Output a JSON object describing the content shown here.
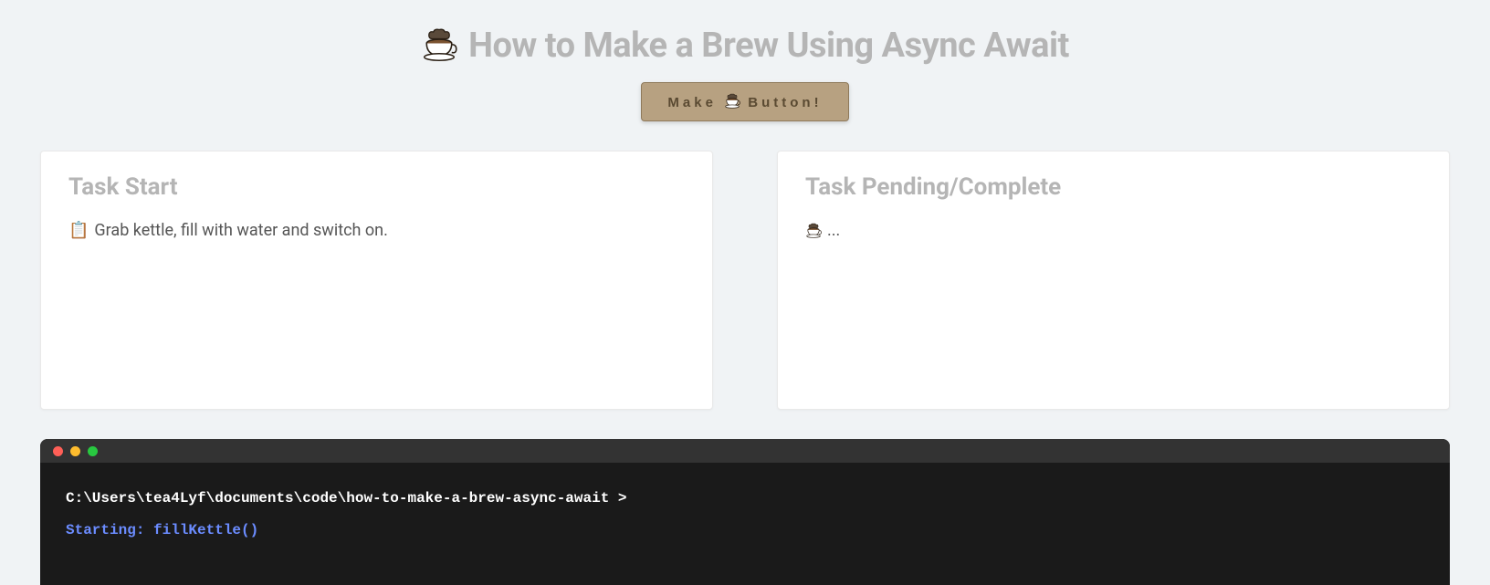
{
  "header": {
    "title": "How to Make a Brew Using Async Await",
    "button_prefix": "Make",
    "button_suffix": "Button!"
  },
  "panels": {
    "left": {
      "heading": "Task Start",
      "items": [
        {
          "icon": "📋",
          "text": "Grab kettle, fill with water and switch on."
        }
      ]
    },
    "right": {
      "heading": "Task Pending/Complete",
      "items": [
        {
          "icon": "coffee",
          "text": "..."
        }
      ]
    }
  },
  "terminal": {
    "prompt": "C:\\Users\\tea4Lyf\\documents\\code\\how-to-make-a-brew-async-await >",
    "lines": [
      {
        "type": "start",
        "text": "Starting: fillKettle()"
      }
    ]
  }
}
